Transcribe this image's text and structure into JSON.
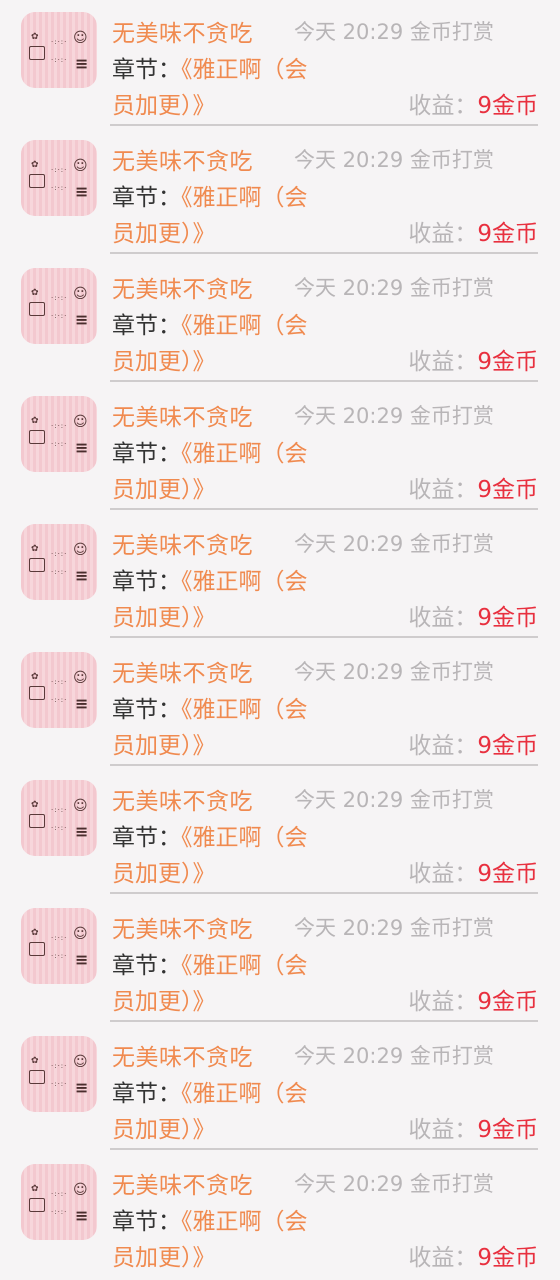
{
  "items": [
    {
      "name": "无美味不贪吃",
      "time": "今天 20:29",
      "type": "金币打赏",
      "chapter_label": "章节：",
      "chapter_line1": "《雅正啊（会",
      "chapter_line2": "员加更）》",
      "earn_label": "收益：",
      "earn_value": "9金币"
    },
    {
      "name": "无美味不贪吃",
      "time": "今天 20:29",
      "type": "金币打赏",
      "chapter_label": "章节：",
      "chapter_line1": "《雅正啊（会",
      "chapter_line2": "员加更）》",
      "earn_label": "收益：",
      "earn_value": "9金币"
    },
    {
      "name": "无美味不贪吃",
      "time": "今天 20:29",
      "type": "金币打赏",
      "chapter_label": "章节：",
      "chapter_line1": "《雅正啊（会",
      "chapter_line2": "员加更）》",
      "earn_label": "收益：",
      "earn_value": "9金币"
    },
    {
      "name": "无美味不贪吃",
      "time": "今天 20:29",
      "type": "金币打赏",
      "chapter_label": "章节：",
      "chapter_line1": "《雅正啊（会",
      "chapter_line2": "员加更）》",
      "earn_label": "收益：",
      "earn_value": "9金币"
    },
    {
      "name": "无美味不贪吃",
      "time": "今天 20:29",
      "type": "金币打赏",
      "chapter_label": "章节：",
      "chapter_line1": "《雅正啊（会",
      "chapter_line2": "员加更）》",
      "earn_label": "收益：",
      "earn_value": "9金币"
    },
    {
      "name": "无美味不贪吃",
      "time": "今天 20:29",
      "type": "金币打赏",
      "chapter_label": "章节：",
      "chapter_line1": "《雅正啊（会",
      "chapter_line2": "员加更）》",
      "earn_label": "收益：",
      "earn_value": "9金币"
    },
    {
      "name": "无美味不贪吃",
      "time": "今天 20:29",
      "type": "金币打赏",
      "chapter_label": "章节：",
      "chapter_line1": "《雅正啊（会",
      "chapter_line2": "员加更）》",
      "earn_label": "收益：",
      "earn_value": "9金币"
    },
    {
      "name": "无美味不贪吃",
      "time": "今天 20:29",
      "type": "金币打赏",
      "chapter_label": "章节：",
      "chapter_line1": "《雅正啊（会",
      "chapter_line2": "员加更）》",
      "earn_label": "收益：",
      "earn_value": "9金币"
    },
    {
      "name": "无美味不贪吃",
      "time": "今天 20:29",
      "type": "金币打赏",
      "chapter_label": "章节：",
      "chapter_line1": "《雅正啊（会",
      "chapter_line2": "员加更）》",
      "earn_label": "收益：",
      "earn_value": "9金币"
    },
    {
      "name": "无美味不贪吃",
      "time": "今天 20:29",
      "type": "金币打赏",
      "chapter_label": "章节：",
      "chapter_line1": "《雅正啊（会",
      "chapter_line2": "员加更）》",
      "earn_label": "收益：",
      "earn_value": "9金币"
    }
  ],
  "colors": {
    "name": "#f08a4f",
    "meta": "#b8b5b7",
    "earn_value": "#e8303f",
    "background": "#f6f4f5"
  }
}
